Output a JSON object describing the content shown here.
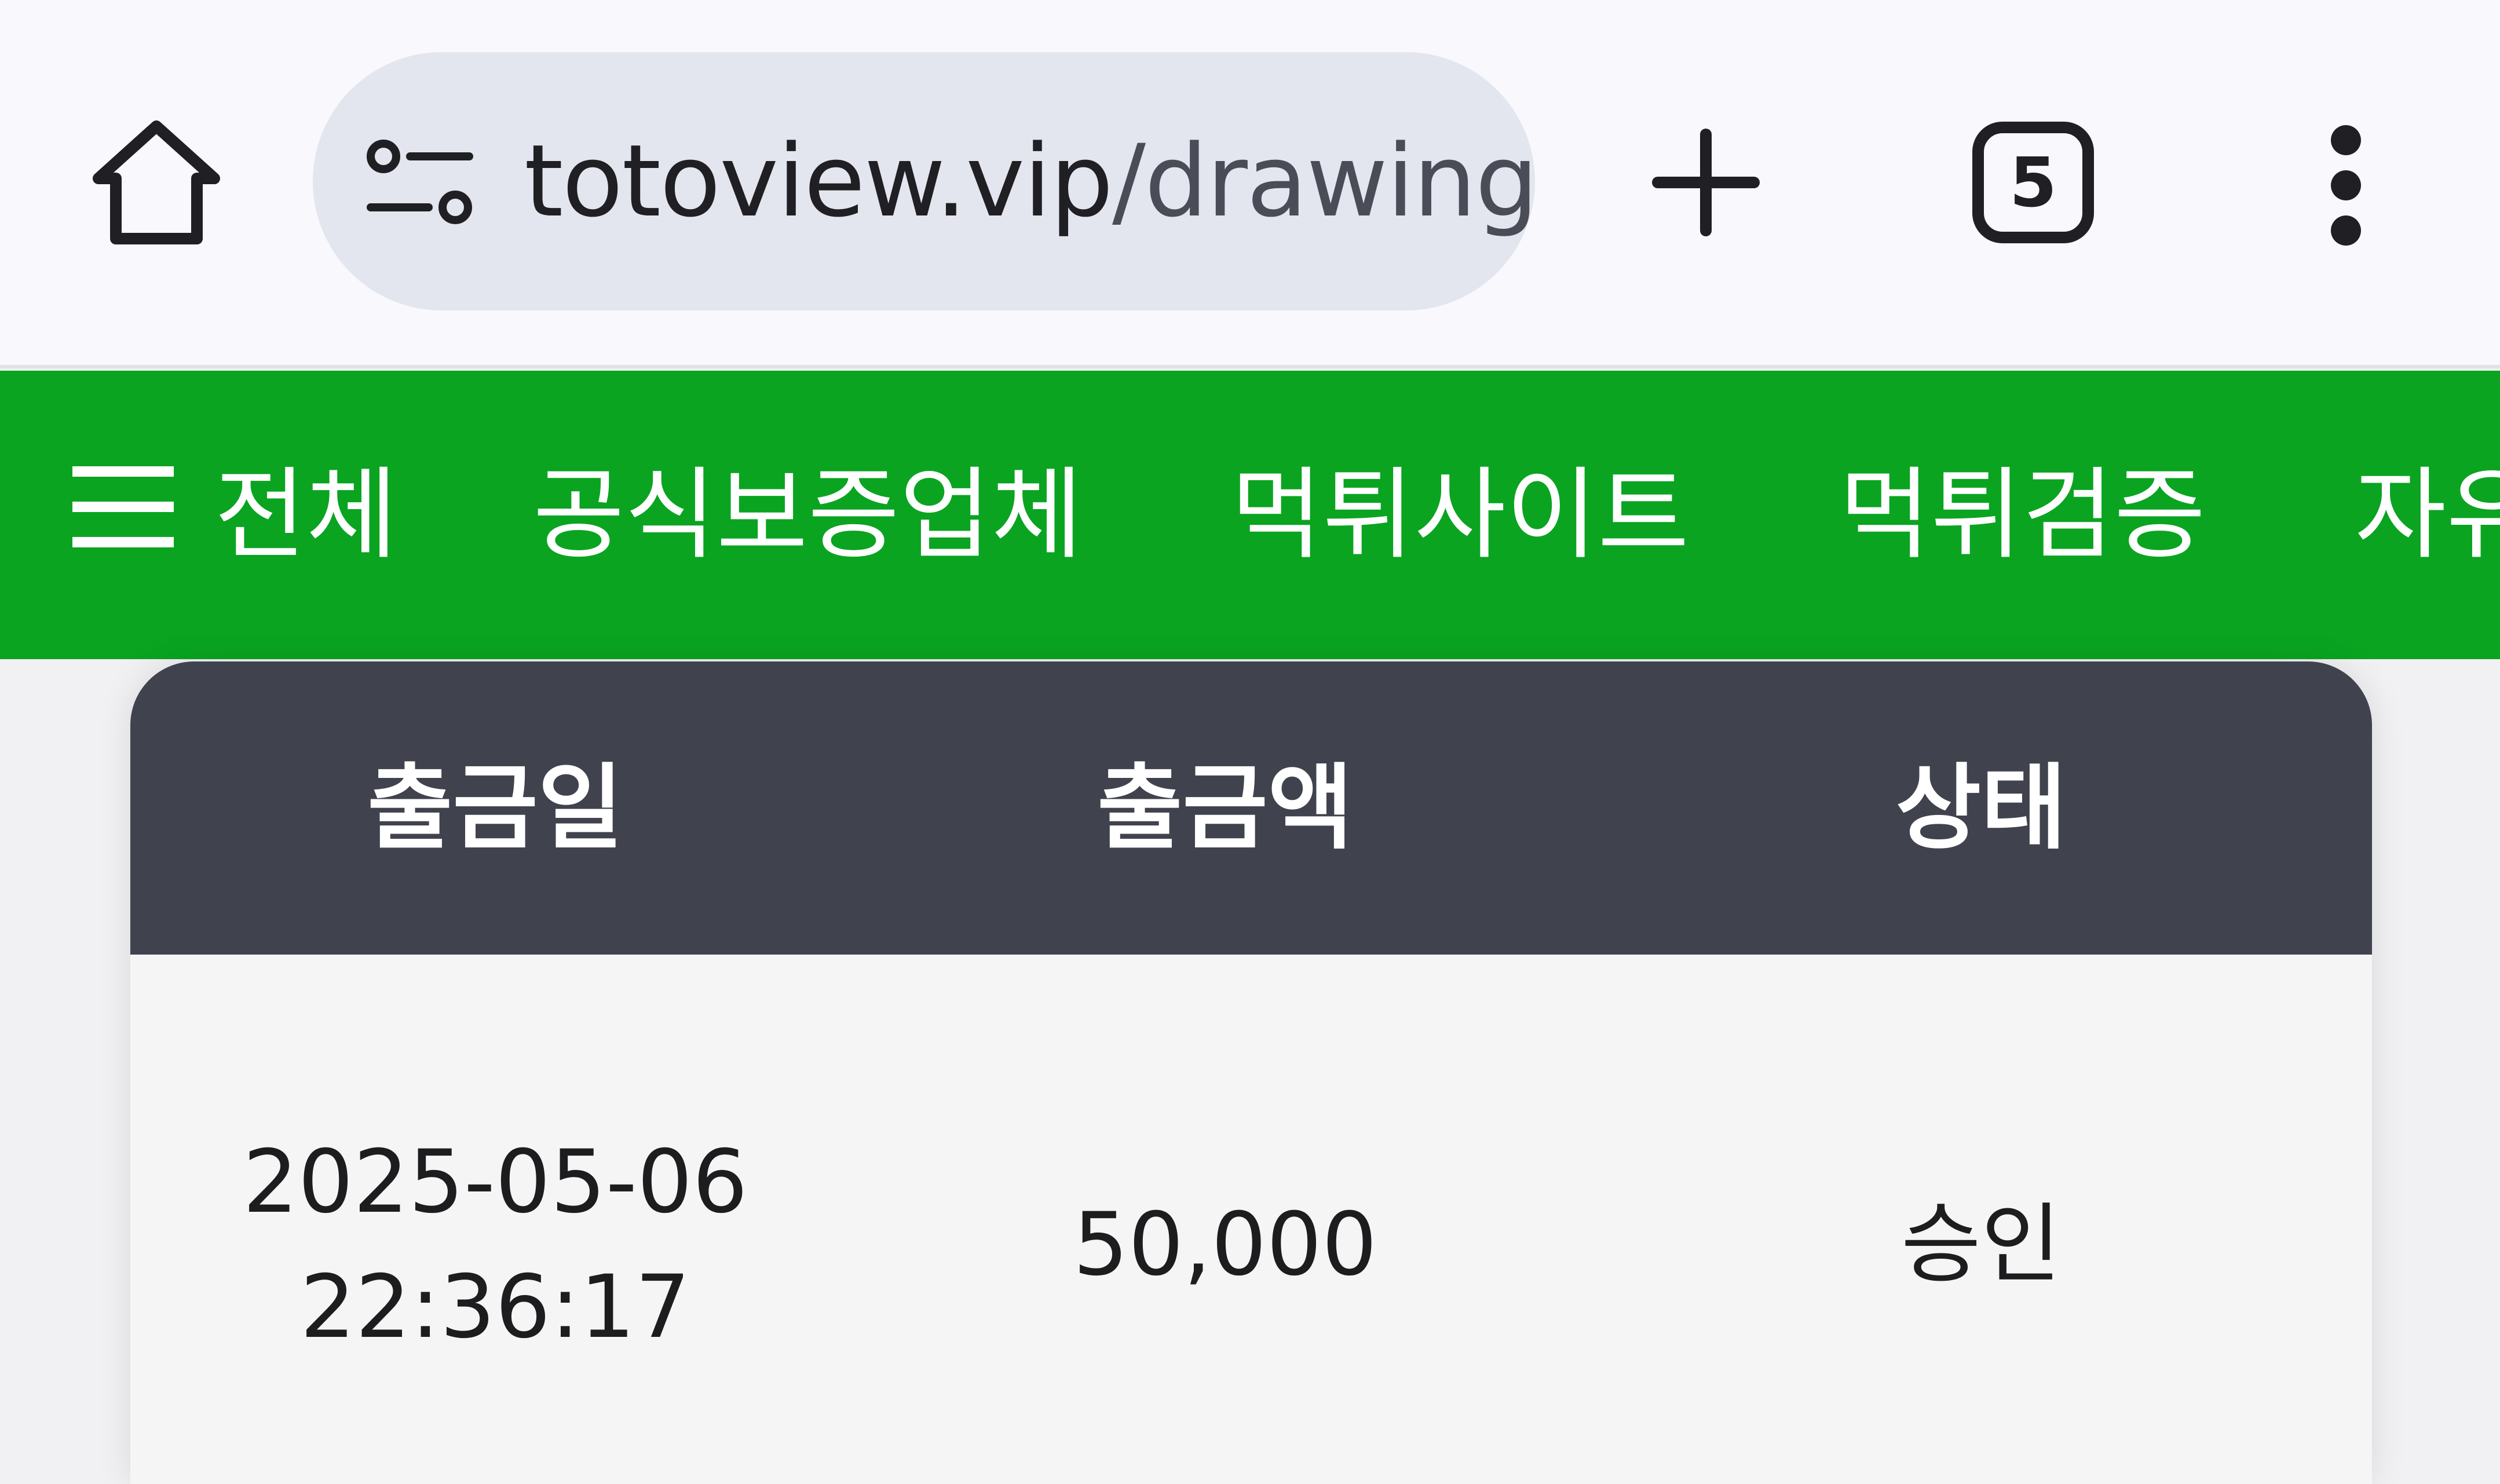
{
  "browser": {
    "url_host": "totoview.vip",
    "url_path": "/drawing",
    "tab_count": "5",
    "icons": {
      "home": "home-icon",
      "site_info": "tune-icon",
      "new_tab": "plus-icon",
      "tabs": "tab-switcher-icon",
      "more": "more-vert-icon"
    }
  },
  "nav": {
    "menu_icon": "hamburger-icon",
    "items": [
      {
        "label": "전체"
      },
      {
        "label": "공식보증업체"
      },
      {
        "label": "먹튀사이트"
      },
      {
        "label": "먹튀검증"
      },
      {
        "label": "자유"
      }
    ],
    "background": "#0aa421"
  },
  "table": {
    "headers": [
      "출금일",
      "출금액",
      "상태"
    ],
    "header_background": "#40434d",
    "rows": [
      {
        "date": "2025-05-06",
        "time": "22:36:17",
        "amount": "50,000",
        "status": "승인"
      }
    ]
  }
}
